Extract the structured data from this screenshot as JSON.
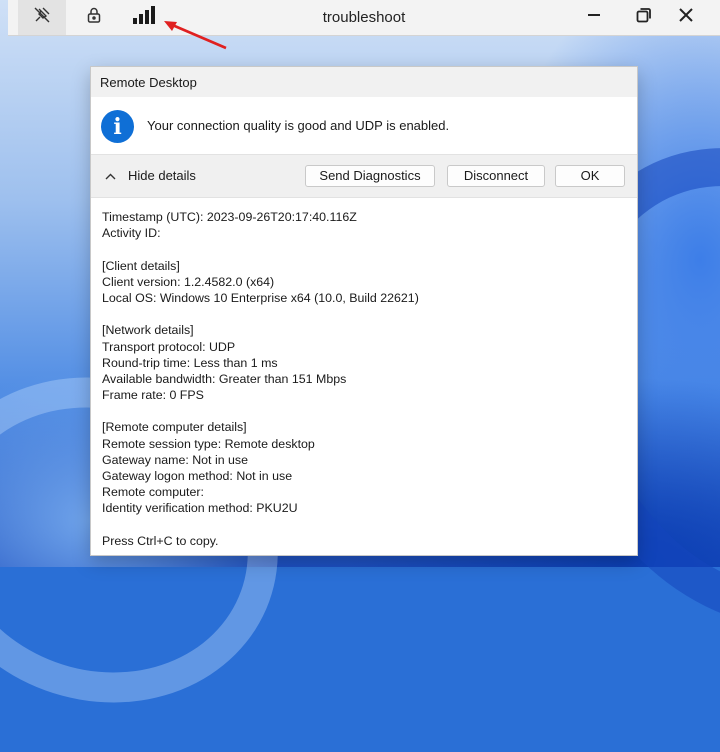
{
  "window": {
    "title": "troubleshoot",
    "toolbar_icons": [
      "pin-off-icon",
      "lock-icon",
      "signal-bars-icon"
    ],
    "controls": [
      "minimize-icon",
      "restore-icon",
      "close-icon"
    ]
  },
  "dialog": {
    "title": "Remote Desktop",
    "message": "Your connection quality is good and UDP is enabled.",
    "hide_details_label": "Hide details",
    "buttons": {
      "send_diagnostics": "Send Diagnostics",
      "disconnect": "Disconnect",
      "ok": "OK"
    },
    "details": [
      "Timestamp (UTC): 2023-09-26T20:17:40.116Z",
      "Activity ID:",
      "",
      "[Client details]",
      "Client version: 1.2.4582.0 (x64)",
      "Local OS: Windows 10 Enterprise x64 (10.0, Build 22621)",
      "",
      "[Network details]",
      "Transport protocol: UDP",
      "Round-trip time: Less than 1 ms",
      "Available bandwidth: Greater than 151 Mbps",
      "Frame rate: 0 FPS",
      "",
      "[Remote computer details]",
      "Remote session type: Remote desktop",
      "Gateway name: Not in use",
      "Gateway logon method: Not in use",
      "Remote computer:",
      "Identity verification method: PKU2U",
      "",
      "Press Ctrl+C to copy."
    ]
  },
  "colors": {
    "info_blue": "#0f6fd6",
    "annotation_red": "#e02020",
    "titlebar_bg": "#f3f3f3"
  }
}
